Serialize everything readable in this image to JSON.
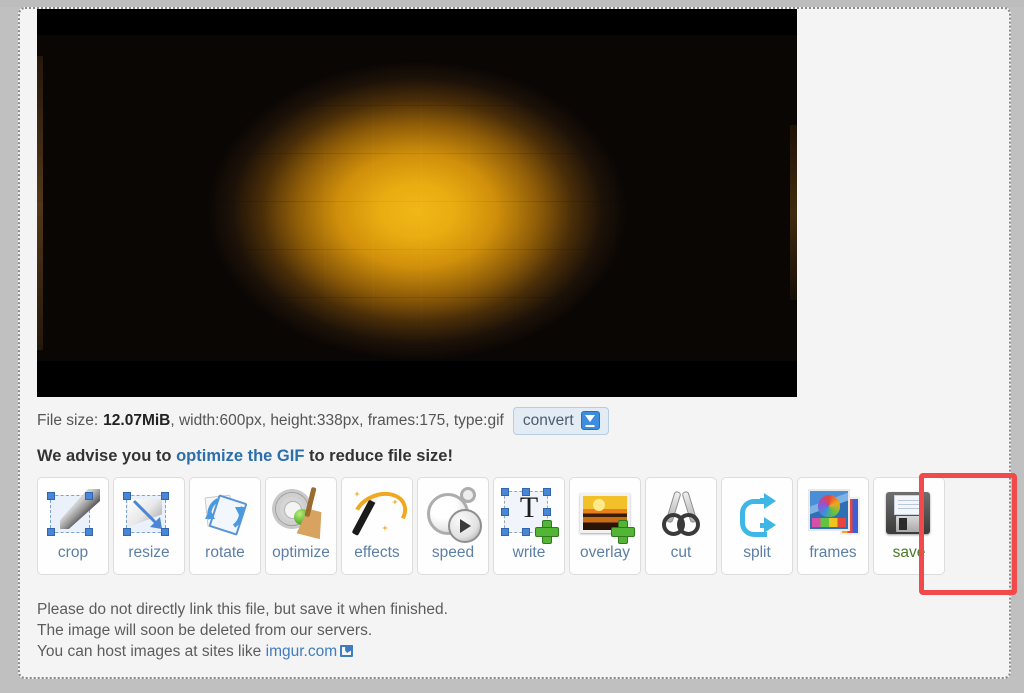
{
  "page": {
    "background_color": "#f4f4f4",
    "panel_border_style": "dotted"
  },
  "preview": {
    "alt_description": "Animated GIF preview frame: dark scene with glowing amber-orange object in center",
    "icon": "gif-preview"
  },
  "meta": {
    "file_size_label": "File size:",
    "file_size_value": "12.07MiB",
    "width_label": ", width:",
    "width_value": " 600px",
    "height_label": ", height:",
    "height_value": " 338px",
    "frames_label": ", frames:",
    "frames_value": " 175",
    "type_label": ", type:",
    "type_value": " gif",
    "full_line": "File size: 12.07MiB, width: 600px, height: 338px, frames: 175, type: gif",
    "convert_label": "convert",
    "convert_icon": "download-arrow-icon"
  },
  "advise": {
    "prefix": "We advise you to ",
    "link_text": "optimize the GIF",
    "suffix": " to reduce file size!",
    "link_color": "#2c6fad"
  },
  "toolbar": {
    "tools": [
      {
        "id": "crop",
        "label": "crop",
        "icon": "crop-icon"
      },
      {
        "id": "resize",
        "label": "resize",
        "icon": "resize-icon"
      },
      {
        "id": "rotate",
        "label": "rotate",
        "icon": "rotate-icon"
      },
      {
        "id": "optimize",
        "label": "optimize",
        "icon": "optimize-icon"
      },
      {
        "id": "effects",
        "label": "effects",
        "icon": "effects-wand-icon"
      },
      {
        "id": "speed",
        "label": "speed",
        "icon": "speed-stopwatch-icon"
      },
      {
        "id": "write",
        "label": "write",
        "icon": "write-text-icon"
      },
      {
        "id": "overlay",
        "label": "overlay",
        "icon": "overlay-image-icon"
      },
      {
        "id": "cut",
        "label": "cut",
        "icon": "scissors-icon"
      },
      {
        "id": "split",
        "label": "split",
        "icon": "split-arrows-icon"
      },
      {
        "id": "frames",
        "label": "frames",
        "icon": "frames-images-icon"
      },
      {
        "id": "save",
        "label": "save",
        "icon": "floppy-disk-icon"
      }
    ],
    "highlighted_tool": "save",
    "highlight_color": "#f24a4a",
    "save_label_color": "#4b7a2a",
    "label_color": "#5b7fa6"
  },
  "footer": {
    "line1": "Please do not directly link this file, but save it when finished.",
    "line2": "The image will soon be deleted from our servers.",
    "line3_prefix": "You can host images at sites like ",
    "line3_link": "imgur.com",
    "line3_icon": "external-link-icon"
  }
}
